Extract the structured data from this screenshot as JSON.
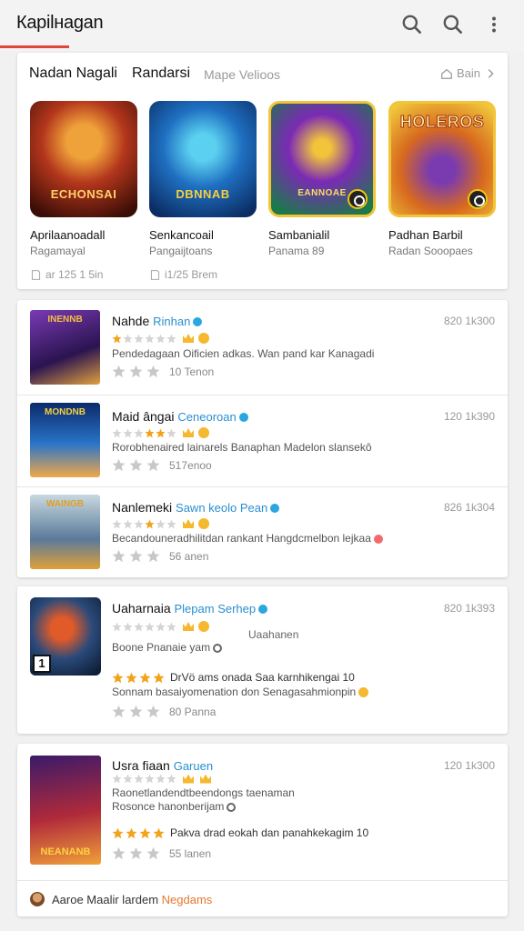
{
  "header": {
    "title": "Карilнagan",
    "icons": [
      "search-icon",
      "search-icon",
      "more-vert-icon"
    ],
    "accent": "#e0443a"
  },
  "featured": {
    "tabs": [
      "Nadan Nagali",
      "Randarsi",
      "Mape Velioos"
    ],
    "see_all": "Bain",
    "items": [
      {
        "name": "Aprilaanoadall",
        "developer": "Ragamayal",
        "meta": "ar 125 1 5in",
        "thumb_text": "ECHONSAI",
        "thumb_colors": [
          "#3a0d06",
          "#b3361c",
          "#f0a23a"
        ]
      },
      {
        "name": "Senkancoail",
        "developer": "Pangaijtoans",
        "meta": "i1/25 Brem",
        "thumb_text": "DBNNAB",
        "thumb_colors": [
          "#0b2d63",
          "#1f6fc1",
          "#5bd0f0"
        ]
      },
      {
        "name": "Sambanialil",
        "developer": "Panama 89",
        "meta": "",
        "thumb_text": "EANNOAE",
        "thumb_colors": [
          "#1a7a4a",
          "#7b2ab5",
          "#f2c43a"
        ]
      },
      {
        "name": "Padhan Barbil",
        "developer": "Radan Sooopaes",
        "meta": "",
        "thumb_text": "HOLEROS",
        "thumb_colors": [
          "#f0c93c",
          "#d86a1e",
          "#7a3ab0"
        ]
      }
    ]
  },
  "list": [
    {
      "title": "Nahde",
      "publisher": "Rinhan",
      "price": "820 1k300",
      "desc": "Pendedagaan Oificien adkas. Wan pand kar Kanagadi",
      "rating": "10 Tenon",
      "thumb_text": "INENNB",
      "thumb_colors": [
        "#2a1450",
        "#7b3ab5",
        "#e0a040"
      ]
    },
    {
      "title": "Maid ângai",
      "publisher": "Ceneoroan",
      "price": "120 1k390",
      "desc": "Rorobhenaired lainarels Banaphan Madelon slansekô",
      "rating": "517enoo",
      "thumb_text": "MONDNB",
      "thumb_colors": [
        "#0c2a6a",
        "#2a74c8",
        "#f0a84a"
      ]
    },
    {
      "title": "Nanlemeki",
      "publisher": "Sawn keolo Pean",
      "price": "826 1k304",
      "desc": "Becandouneradhilitdan rankant Hangdcmelbon lejkaa",
      "rating": "56 anen",
      "thumb_text": "WAINGB",
      "thumb_colors": [
        "#5a7a9a",
        "#c8d8e0",
        "#e0a03a"
      ]
    }
  ],
  "card3": {
    "title": "Uaharnaia",
    "publisher": "Plepam Serhep",
    "price": "820 1k393",
    "line1": "Uaahanen",
    "desc": "Boone Pnanaie yam",
    "gold_text": "DrVö ams onada Saa karnhikengai 10",
    "desc2": "Sonnam basaiyomenation don Senagasahmionpin",
    "rating": "80 Panna",
    "thumb_colors": [
      "#10203a",
      "#2a4a7a",
      "#e05a2a"
    ]
  },
  "card4": {
    "title": "Usra fiaan",
    "publisher": "Garuen",
    "price": "120 1k300",
    "line1": "Raonetlandendtbeendongs taenaman",
    "desc": "Rosonce hanonberijam",
    "gold_text": "Pakva drad eokah dan panahkekagim 10",
    "rating": "55 lanen",
    "thumb_text": "NEANANB",
    "thumb_colors": [
      "#3a1a6a",
      "#b02a3a",
      "#f0a03a"
    ],
    "footer_text": "Aaroe Maalir lardem",
    "footer_accent": "Negdams"
  }
}
